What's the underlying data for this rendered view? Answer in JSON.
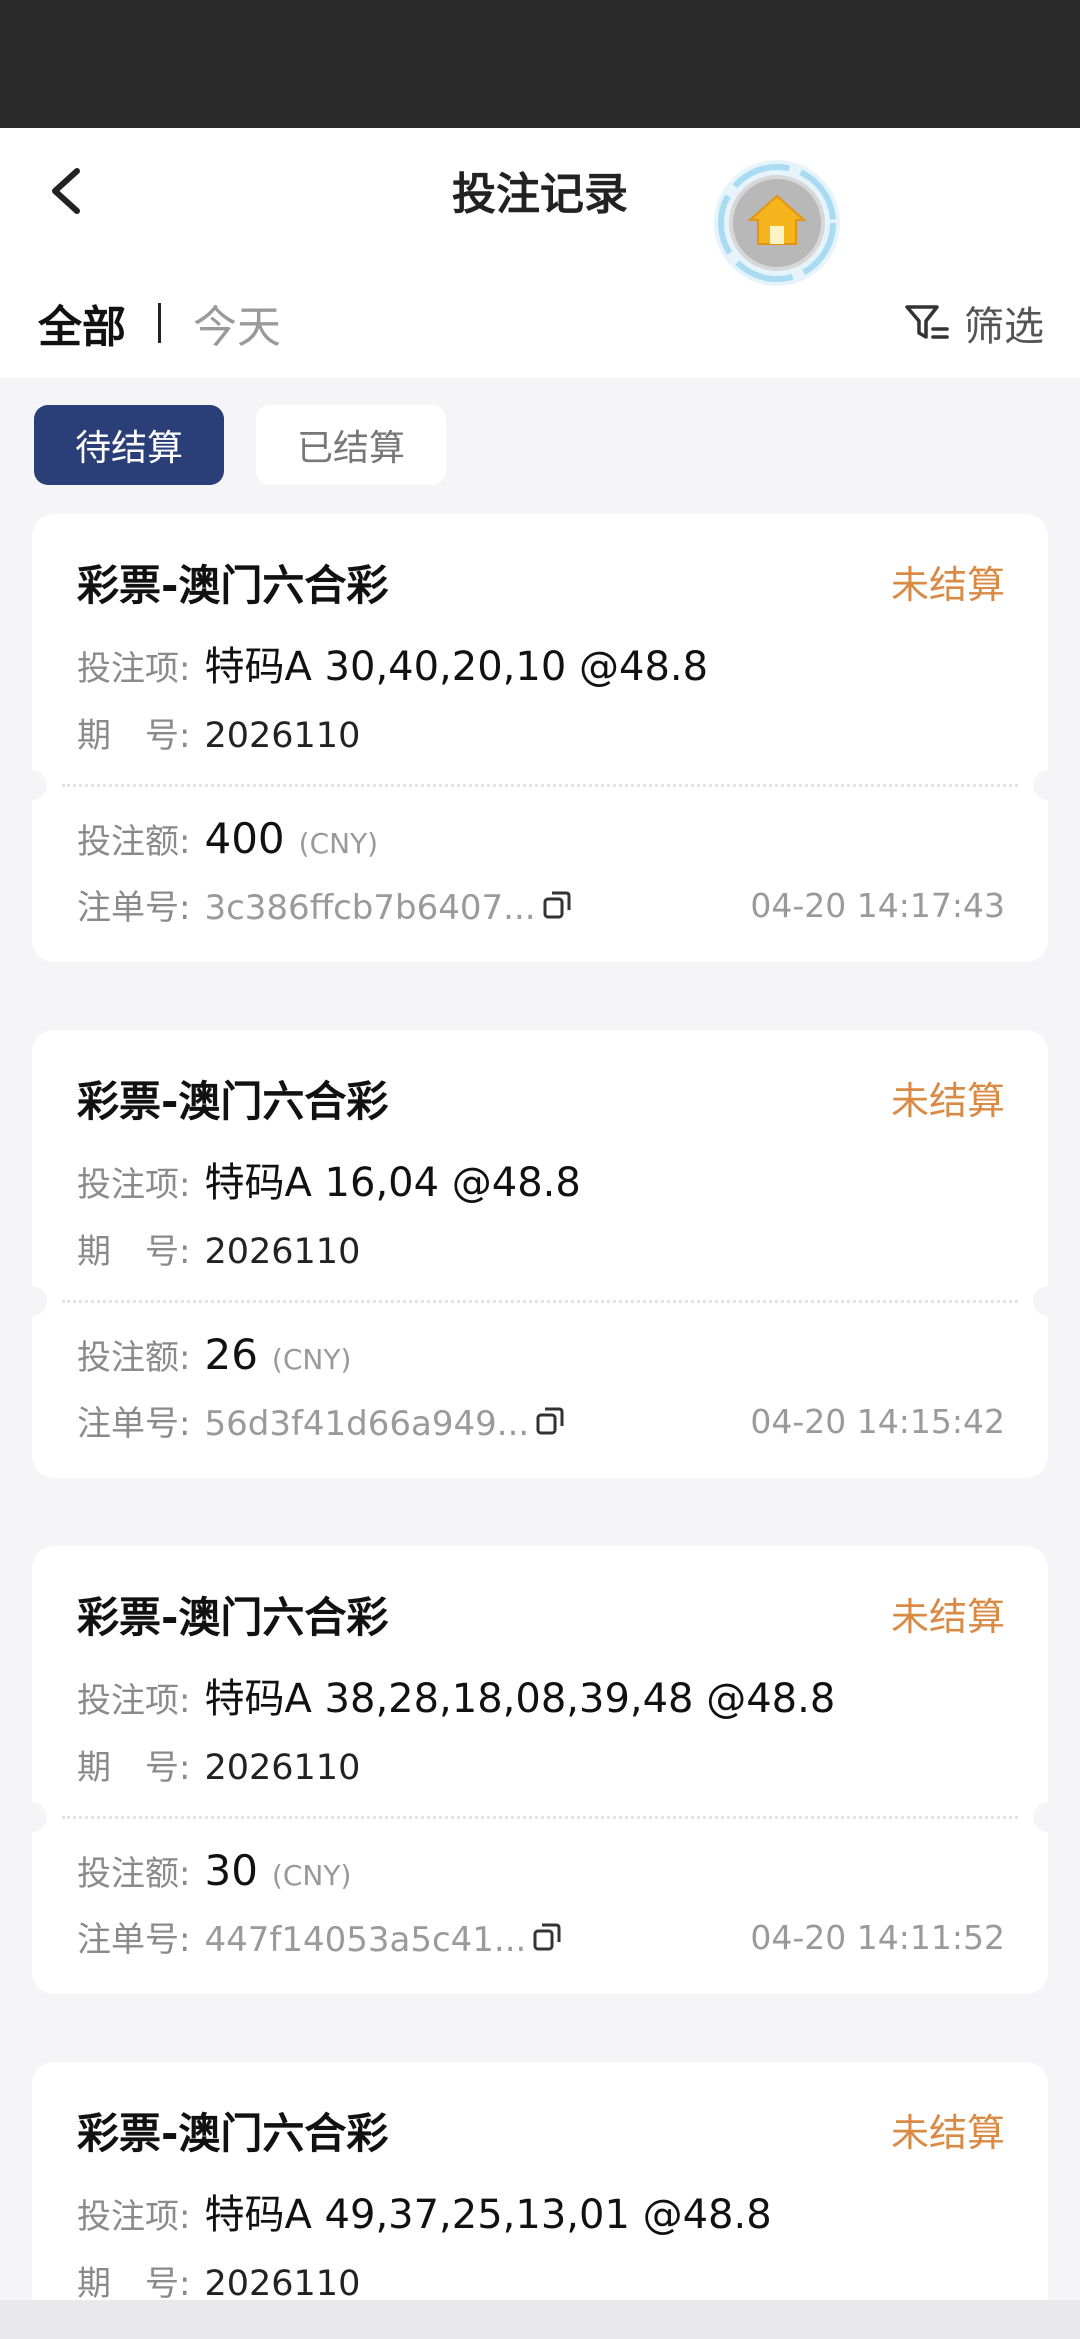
{
  "header": {
    "title": "投注记录",
    "range_tabs": [
      "全部",
      "今天"
    ],
    "filter_label": "筛选"
  },
  "status_tabs": [
    "待结算",
    "已结算"
  ],
  "labels": {
    "bet_item": "投注项:",
    "issue": "期　号:",
    "amount": "投注额:",
    "order_no": "注单号:",
    "currency": "(CNY)"
  },
  "cards": [
    {
      "title": "彩票-澳门六合彩",
      "status": "未结算",
      "bet_item": "特码A 30,40,20,10 @48.8",
      "issue": "2026110",
      "amount": "400",
      "order_no": "3c386ffcb7b6407...",
      "time": "04-20 14:17:43"
    },
    {
      "title": "彩票-澳门六合彩",
      "status": "未结算",
      "bet_item": "特码A 16,04 @48.8",
      "issue": "2026110",
      "amount": "26",
      "order_no": "56d3f41d66a949...",
      "time": "04-20 14:15:42"
    },
    {
      "title": "彩票-澳门六合彩",
      "status": "未结算",
      "bet_item": "特码A 38,28,18,08,39,48 @48.8",
      "issue": "2026110",
      "amount": "30",
      "order_no": "447f14053a5c41...",
      "time": "04-20 14:11:52"
    },
    {
      "title": "彩票-澳门六合彩",
      "status": "未结算",
      "bet_item": "特码A 49,37,25,13,01 @48.8",
      "issue": "2026110"
    }
  ],
  "colors": {
    "accent": "#2a3f78",
    "pending": "#d98a44"
  },
  "icons": [
    "back-arrow-icon",
    "home-icon",
    "filter-icon",
    "copy-icon"
  ]
}
